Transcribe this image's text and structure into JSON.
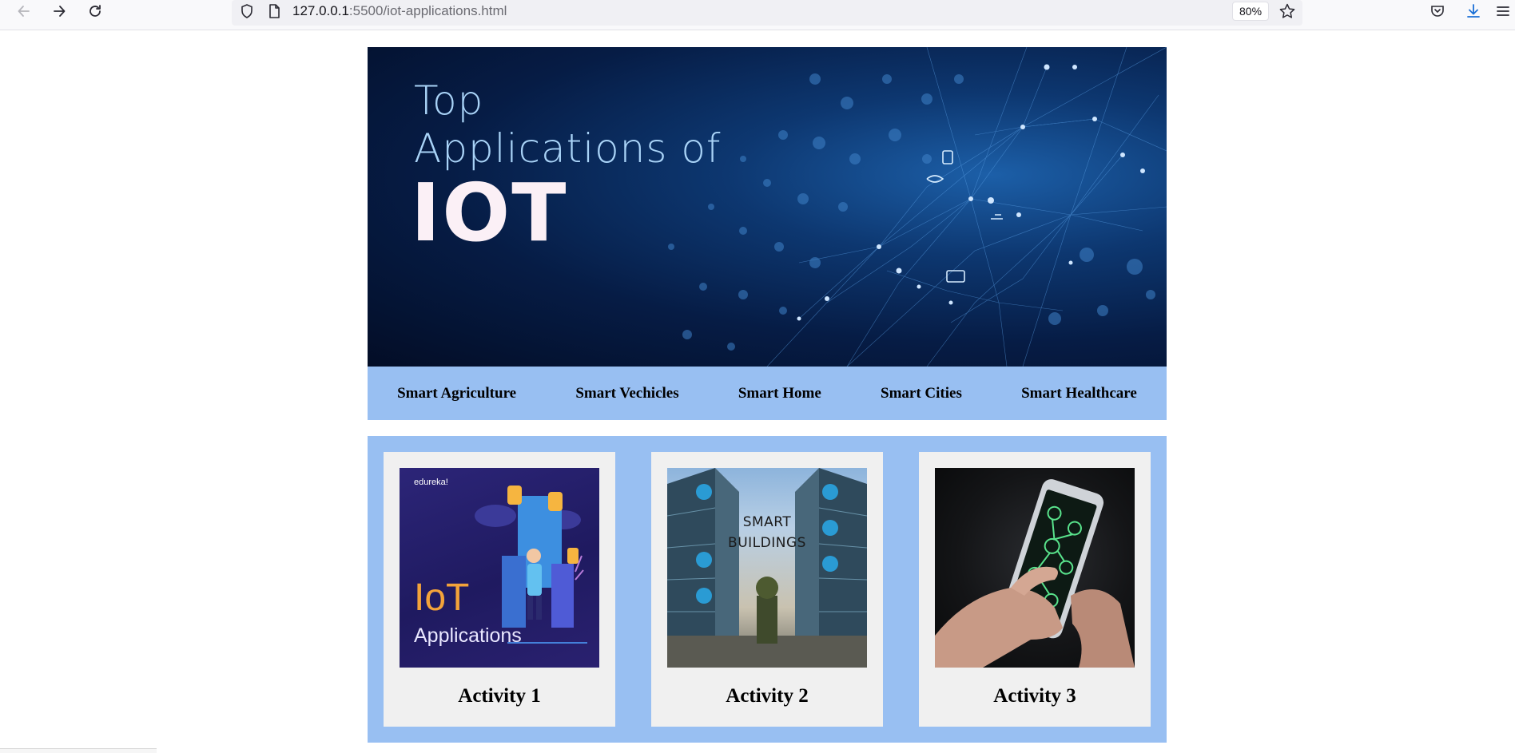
{
  "browser": {
    "url_host": "127.0.0.1",
    "url_path": ":5500/iot-applications.html",
    "zoom": "80%",
    "icons": [
      "back-arrow-icon",
      "forward-arrow-icon",
      "reload-icon",
      "shield-icon",
      "page-icon",
      "star-icon",
      "pocket-icon",
      "download-icon",
      "menu-icon"
    ]
  },
  "hero": {
    "line1": "Top",
    "line2": "Applications of",
    "line3": "IOT"
  },
  "nav": {
    "items": [
      "Smart Agriculture",
      "Smart Vechicles",
      "Smart Home",
      "Smart Cities",
      "Smart Healthcare"
    ]
  },
  "activities": [
    {
      "title": "Activity 1",
      "image": {
        "brand": "edureka!",
        "heading": "IoT",
        "subheading": "Applications"
      }
    },
    {
      "title": "Activity 2",
      "image": {
        "caption_line1": "SMART",
        "caption_line2": "BUILDINGS"
      }
    },
    {
      "title": "Activity 3"
    }
  ],
  "colors": {
    "nav_background": "#98bff2",
    "card_background": "#f0f0f0",
    "hero_dark": "#061c45",
    "hero_title": "#a9d3f7"
  }
}
